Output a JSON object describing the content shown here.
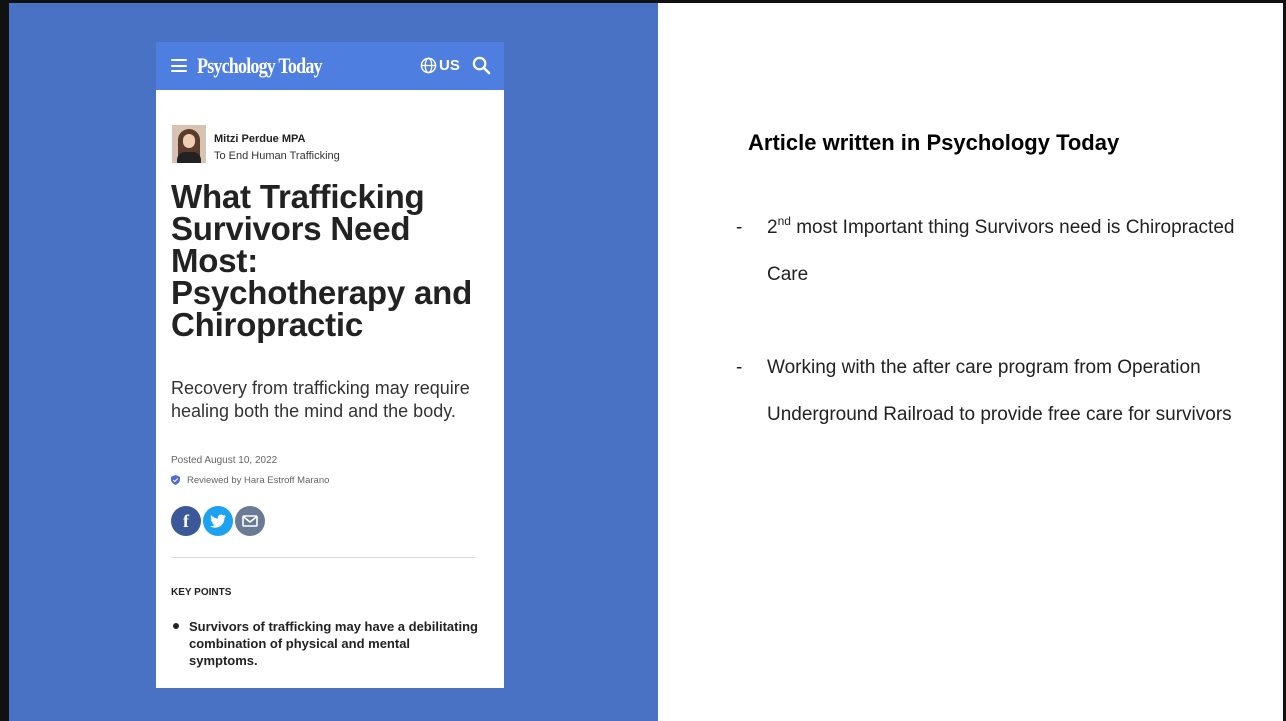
{
  "header": {
    "brand": "Psychology Today",
    "locale": "US"
  },
  "article": {
    "author_name": "Mitzi Perdue MPA",
    "author_topic": "To End Human Trafficking",
    "headline": "What Trafficking Survivors Need Most: Psychotherapy and Chiropractic",
    "subheadline": "Recovery from trafficking may require healing both the mind and the body.",
    "posted": "Posted August 10, 2022",
    "reviewed": "Reviewed by Hara Estroff Marano",
    "key_points_title": "KEY POINTS",
    "key_point_1": "Survivors of trafficking may have a debilitating combination of physical and mental symptoms."
  },
  "slide": {
    "title": "Article written in Psychology Today",
    "bullets": [
      {
        "dash": "-",
        "ordinal": "2",
        "superscript": "nd",
        "text": " most Important thing Survivors need is Chiropracted Care"
      },
      {
        "dash": "-",
        "text": "Working with the after care program from Operation Underground Railroad to provide free care for survivors"
      }
    ]
  },
  "icons": [
    "menu-icon",
    "globe-icon",
    "search-icon",
    "shield-icon",
    "facebook-icon",
    "twitter-icon",
    "email-icon"
  ],
  "colors": {
    "panel_blue": "#4a72c4",
    "header_blue": "#4d7ee0",
    "facebook": "#3b5998",
    "twitter": "#1da1f2",
    "email": "#6c7b95"
  }
}
